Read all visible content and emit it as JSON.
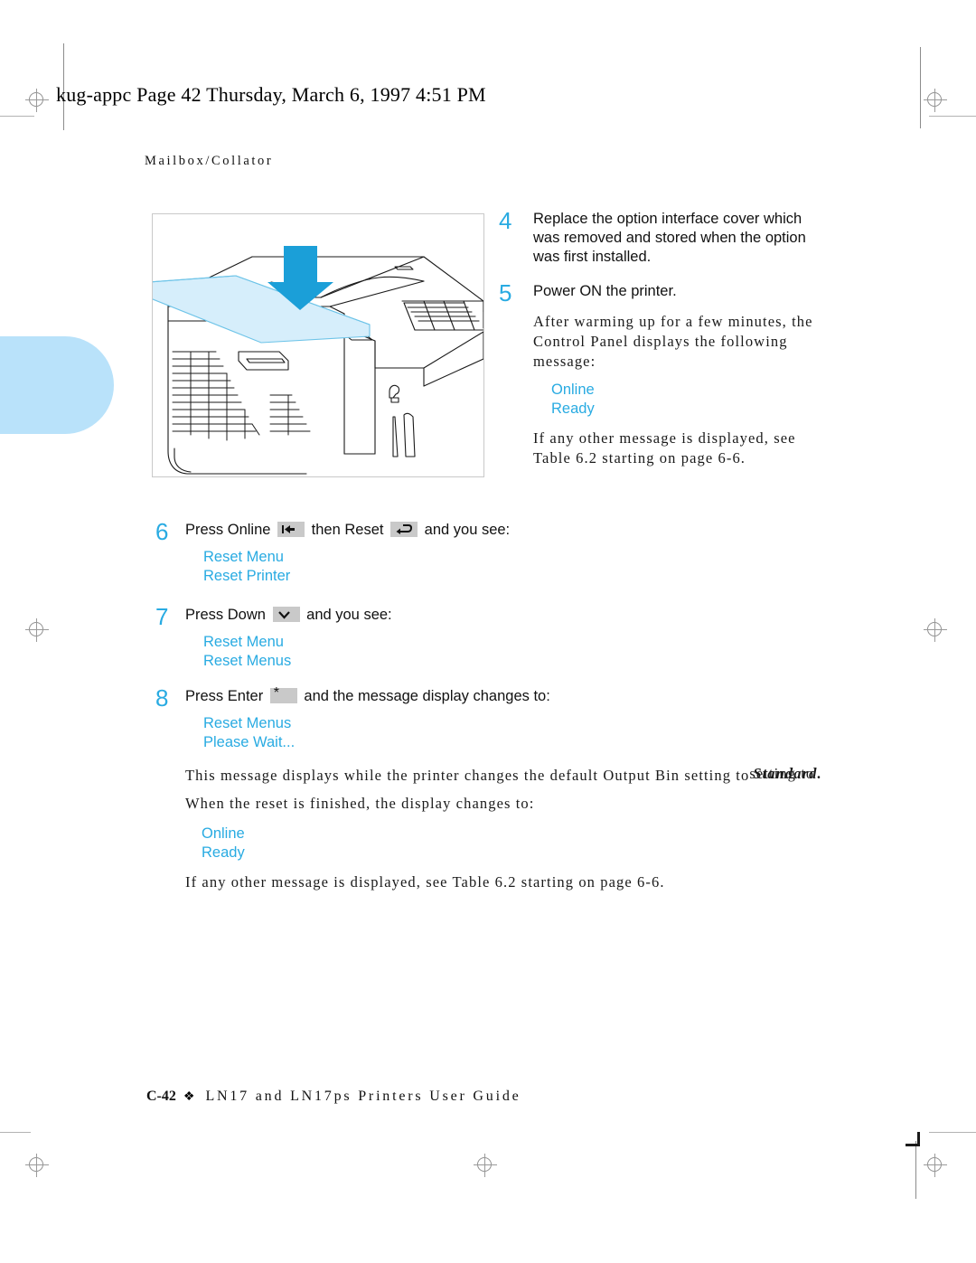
{
  "page": {
    "file_stamp": "kug-appc  Page 42  Thursday, March 6, 1997  4:51 PM",
    "running_head": "Mailbox/Collator",
    "accent_color": "#29ABE2",
    "tab_color": "#b9e2fa"
  },
  "figure": {
    "caption": "",
    "alt_name": "printer-option-interface-cover-illustration"
  },
  "steps": [
    {
      "number": "4",
      "lines": [
        "Replace the option interface cover which",
        "was removed and stored when the option",
        "was first installed."
      ]
    },
    {
      "number": "5",
      "lines": [
        "Power ON the printer."
      ],
      "sub_paragraph": [
        "After warming up for a few minutes, the",
        "Control Panel displays the following",
        "message:"
      ],
      "display_lines": [
        "Online",
        "Ready"
      ],
      "after_paragraph": [
        "If any other message is displayed, see",
        "Table 6.2 starting on page 6-6."
      ]
    },
    {
      "number": "6",
      "text_before": "Press Online",
      "key1": "left-arrow-bar",
      "text_middle": "then Reset",
      "key2": "return-arrow",
      "text_after": "and you see:",
      "display_lines": [
        "Reset Menu",
        "Reset Printer"
      ]
    },
    {
      "number": "7",
      "text_before": "Press Down",
      "key1": "chevron-down",
      "text_after": "and you see:",
      "display_lines": [
        "Reset Menu",
        "Reset Menus"
      ]
    },
    {
      "number": "8",
      "text_before": "Press Enter",
      "key1": "asterisk",
      "text_after": "and the message display changes to:",
      "display_lines": [
        "Reset Menus",
        "Please Wait..."
      ]
    }
  ],
  "closing": {
    "paragraph_1_main": "This message displays while the printer changes the default Output Bin setting to",
    "paragraph_1_overlap_base": "setting to",
    "paragraph_1_overlap_italic": "Standard.",
    "paragraph_2": "When the reset is finished, the display changes to:",
    "display_lines": [
      "Online",
      "Ready"
    ],
    "paragraph_3": "If any other message is displayed, see Table 6.2 starting on page 6-6."
  },
  "footer": {
    "page_number": "C-42",
    "separator": "❖",
    "title": "LN17 and LN17ps Printers User Guide"
  }
}
